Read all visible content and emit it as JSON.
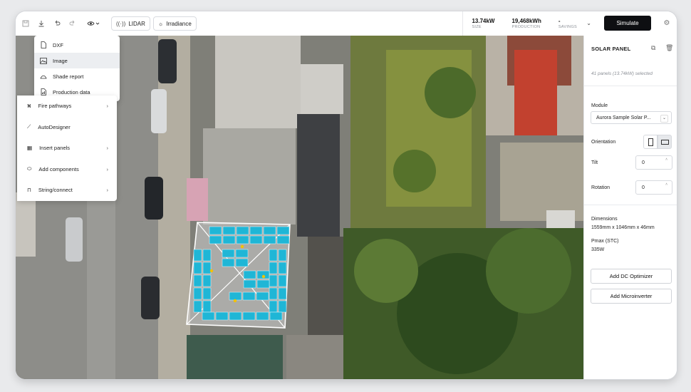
{
  "toolbar": {
    "lidar_label": "LIDAR",
    "irradiance_label": "Irradiance",
    "simulate_label": "Simulate"
  },
  "stats": [
    {
      "value": "13.74kW",
      "label": "SIZE"
    },
    {
      "value": "19,468kWh",
      "label": "PRODUCTION"
    },
    {
      "value": "-",
      "label": "SAVINGS"
    }
  ],
  "export_menu": {
    "items": [
      {
        "label": "DXF",
        "icon": "file-icon"
      },
      {
        "label": "Image",
        "icon": "image-icon"
      },
      {
        "label": "Shade report",
        "icon": "shade-icon"
      },
      {
        "label": "Production data",
        "icon": "chart-file-icon"
      }
    ],
    "selected": "Image"
  },
  "tools_menu": {
    "items": [
      {
        "label": "Fire pathways",
        "icon": "fire-pathways-icon"
      },
      {
        "label": "AutoDesigner",
        "icon": "wand-icon"
      },
      {
        "label": "Insert panels",
        "icon": "grid-icon"
      },
      {
        "label": "Add components",
        "icon": "component-icon"
      },
      {
        "label": "String/connect",
        "icon": "string-icon"
      }
    ]
  },
  "panel": {
    "title": "SOLAR PANEL",
    "subtitle": "41 panels (13.74kW) selected",
    "module_label": "Module",
    "module_value": "Aurora Sample Solar P...",
    "orientation_label": "Orientation",
    "tilt_label": "Tilt",
    "tilt_value": "0",
    "rotation_label": "Rotation",
    "rotation_value": "0",
    "dimensions_label": "Dimensions",
    "dimensions_value": "1559mm x 1046mm x 46mm",
    "pmax_label": "Pmax (STC)",
    "pmax_value": "335W",
    "dc_optimizer_label": "Add DC Optimizer",
    "microinverter_label": "Add Microinverter"
  },
  "colors": {
    "panel_fill": "#1fb6d6",
    "simulate_bg": "#0e0f12",
    "roof_outline": "#ffffff"
  }
}
